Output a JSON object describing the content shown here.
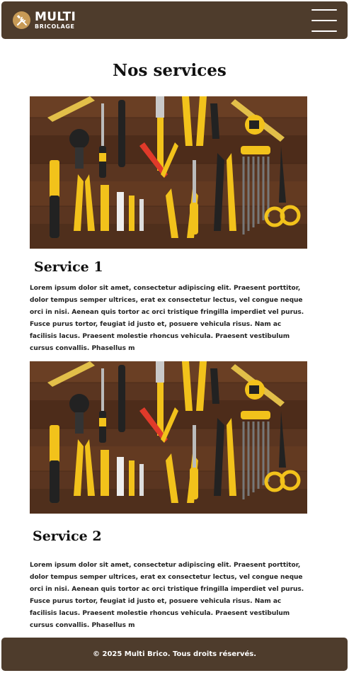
{
  "header": {
    "logo_main": "MULTI",
    "logo_sub": "BRICOLAGE",
    "logo_icon": "tools-icon",
    "menu_icon": "hamburger-menu-icon",
    "background": "#4e3c2c"
  },
  "main": {
    "title": "Nos services",
    "services": [
      {
        "title": "Service 1",
        "text": "Lorem ipsum dolor sit amet, consectetur adipiscing elit. Praesent porttitor, dolor tempus semper ultrices, erat ex consectetur lectus, vel congue neque orci in nisi. Aenean quis tortor ac orci tristique fringilla imperdiet vel purus. Fusce purus tortor, feugiat id justo et, posuere vehicula risus. Nam ac facilisis lacus. Praesent molestie rhoncus vehicula. Praesent vestibulum cursus convallis. Phasellus m",
        "image": "tools-flatlay-image"
      },
      {
        "title": "Service 2",
        "text": "Lorem ipsum dolor sit amet, consectetur adipiscing elit. Praesent porttitor, dolor tempus semper ultrices, erat ex consectetur lectus, vel congue neque orci in nisi. Aenean quis tortor ac orci tristique fringilla imperdiet vel purus. Fusce purus tortor, feugiat id justo et, posuere vehicula risus. Nam ac facilisis lacus. Praesent molestie rhoncus vehicula. Praesent vestibulum cursus convallis. Phasellus m",
        "image": "tools-flatlay-image"
      }
    ]
  },
  "footer": {
    "copyright": "© 2025 Multi Brico. Tous droits réservés."
  },
  "colors": {
    "brand_brown": "#4e3c2c",
    "accent_gold": "#c79a56",
    "tool_yellow": "#f2c21b"
  }
}
